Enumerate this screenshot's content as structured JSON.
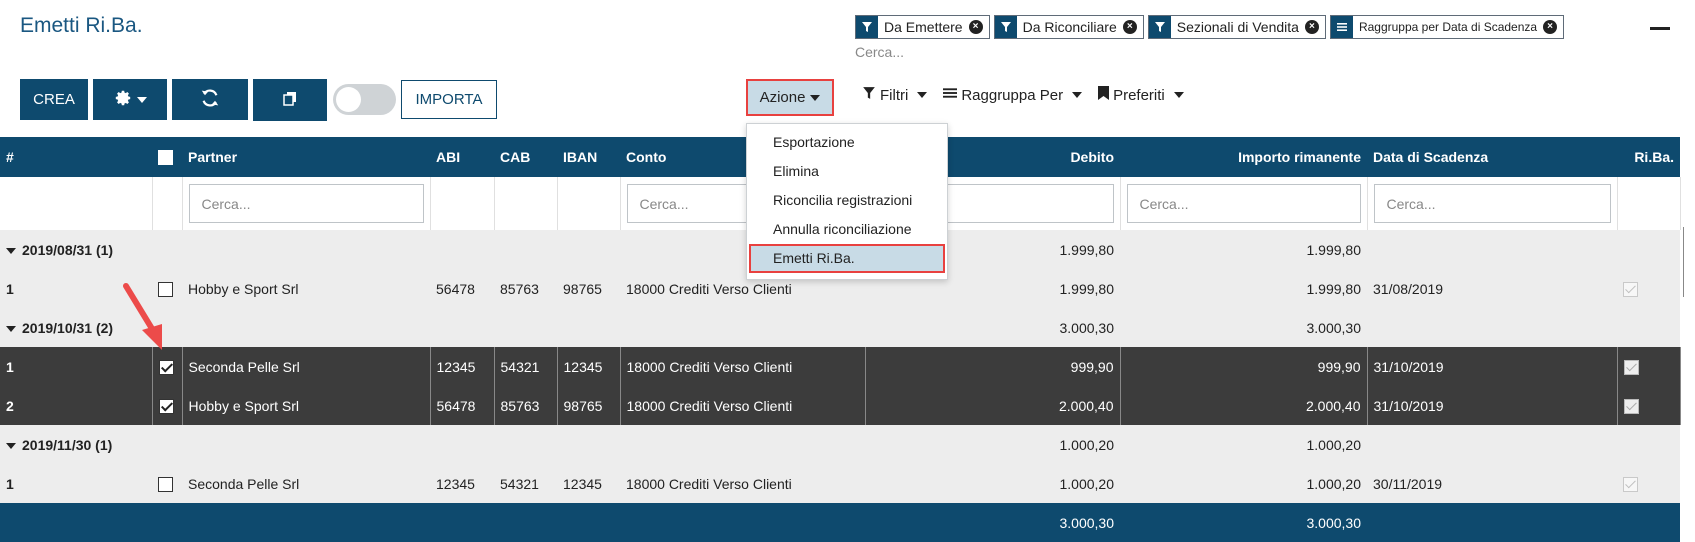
{
  "page": {
    "title": "Emetti Ri.Ba."
  },
  "facets": [
    {
      "type": "filter-icon",
      "label": "Da Emettere"
    },
    {
      "type": "filter-icon",
      "label": "Da Riconciliare"
    },
    {
      "type": "filter-icon",
      "label": "Sezionali di Vendita"
    },
    {
      "type": "group-icon",
      "label": "Raggruppa per Data di Scadenza"
    }
  ],
  "search": {
    "placeholder": "Cerca..."
  },
  "toolbar": {
    "crea_label": "CREA",
    "importa_label": "IMPORTA",
    "azione_label": "Azione",
    "filtri_label": "Filtri",
    "raggruppa_label": "Raggruppa Per",
    "preferiti_label": "Preferiti"
  },
  "action_menu": {
    "items": [
      "Esportazione",
      "Elimina",
      "Riconcilia registrazioni",
      "Annulla riconciliazione",
      "Emetti Ri.Ba."
    ],
    "active_index": 4
  },
  "table": {
    "columns": [
      "#",
      "Partner",
      "ABI",
      "CAB",
      "IBAN",
      "Conto",
      "Debito",
      "Importo rimanente",
      "Data di Scadenza",
      "Ri.Ba."
    ],
    "filter_placeholder": "Cerca...",
    "groups": [
      {
        "label": "2019/08/31 (1)",
        "debito": "1.999,80",
        "rimanente": "1.999,80",
        "rows": [
          {
            "num": "1",
            "partner": "Hobby e Sport Srl",
            "abi": "56478",
            "cab": "85763",
            "iban": "98765",
            "conto": "18000 Crediti Verso Clienti",
            "debito": "1.999,80",
            "rimanente": "1.999,80",
            "scadenza": "31/08/2019",
            "selected": false
          }
        ]
      },
      {
        "label": "2019/10/31 (2)",
        "debito": "3.000,30",
        "rimanente": "3.000,30",
        "rows": [
          {
            "num": "1",
            "partner": "Seconda Pelle Srl",
            "abi": "12345",
            "cab": "54321",
            "iban": "12345",
            "conto": "18000 Crediti Verso Clienti",
            "debito": "999,90",
            "rimanente": "999,90",
            "scadenza": "31/10/2019",
            "selected": true
          },
          {
            "num": "2",
            "partner": "Hobby e Sport Srl",
            "abi": "56478",
            "cab": "85763",
            "iban": "98765",
            "conto": "18000 Crediti Verso Clienti",
            "debito": "2.000,40",
            "rimanente": "2.000,40",
            "scadenza": "31/10/2019",
            "selected": true
          }
        ]
      },
      {
        "label": "2019/11/30 (1)",
        "debito": "1.000,20",
        "rimanente": "1.000,20",
        "rows": [
          {
            "num": "1",
            "partner": "Seconda Pelle Srl",
            "abi": "12345",
            "cab": "54321",
            "iban": "12345",
            "conto": "18000 Crediti Verso Clienti",
            "debito": "1.000,20",
            "rimanente": "1.000,20",
            "scadenza": "30/11/2019",
            "selected": false
          }
        ]
      }
    ],
    "footer": {
      "debito": "3.000,30",
      "rimanente": "3.000,30"
    }
  },
  "colors": {
    "primary": "#0e4a6e",
    "highlight": "#e8413f",
    "selected_row": "#3c3c3c",
    "active_menu": "#c8dbe6"
  }
}
